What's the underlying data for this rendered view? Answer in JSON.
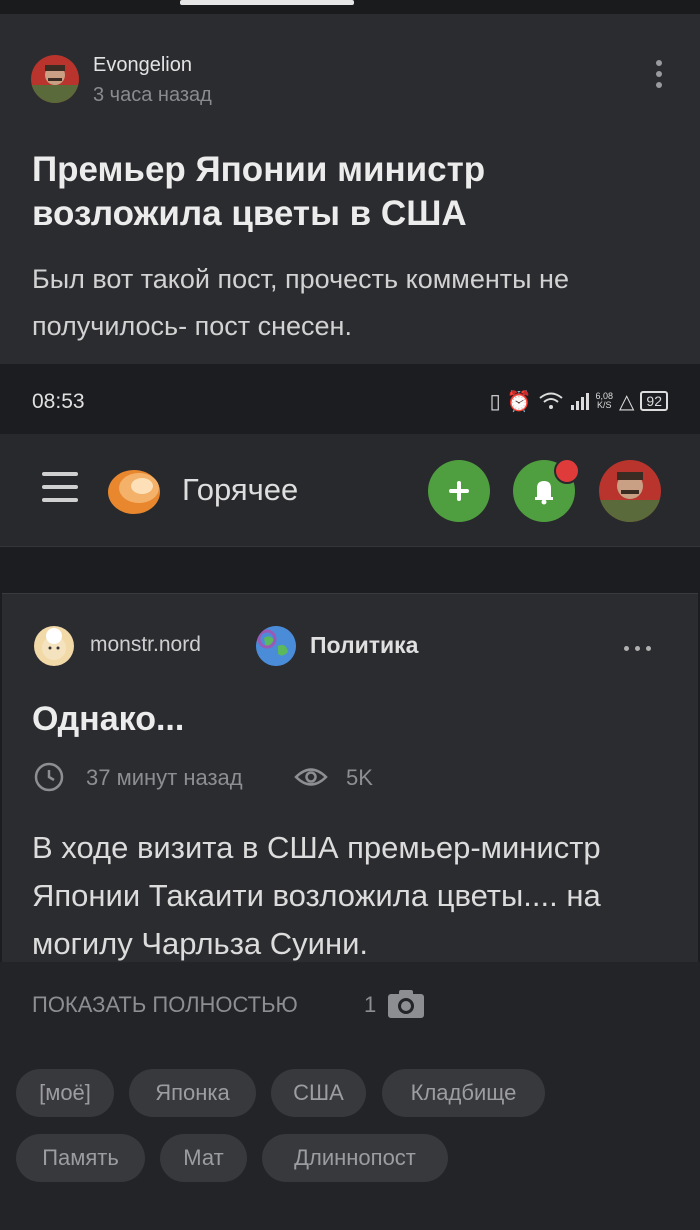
{
  "post": {
    "author": "Evongelion",
    "time": "3 часа назад",
    "title": "Премьер Японии министр возложила цветы в США",
    "text": "Был вот такой пост, прочесть комменты не получилось- пост снесен."
  },
  "screenshot": {
    "status_time": "08:53",
    "net_speed_top": "6,08",
    "net_speed_bottom": "K/S",
    "battery": "92",
    "section_title": "Горячее",
    "card": {
      "author": "monstr.nord",
      "community": "Политика",
      "title": "Однако...",
      "time": "37 минут назад",
      "views": "5K",
      "body": "В ходе визита в США премьер-министр Японии Такаити возложила цветы.... на могилу Чарльза Суини."
    }
  },
  "footer": {
    "show_full": "ПОКАЗАТЬ ПОЛНОСТЬЮ",
    "photo_count": "1",
    "tags": [
      "[моё]",
      "Японка",
      "США",
      "Кладбище",
      "Память",
      "Мат",
      "Длиннопост"
    ]
  },
  "colors": {
    "accent_green": "#4f9e3f",
    "notification_red": "#e03b3b",
    "background": "#202124"
  }
}
